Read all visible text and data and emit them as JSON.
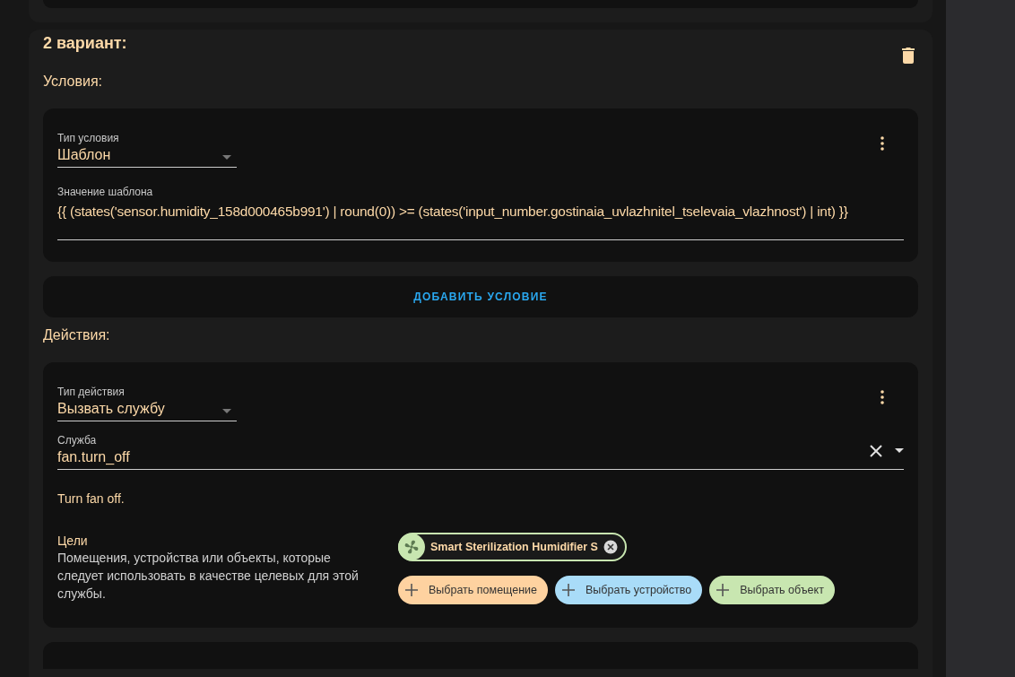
{
  "variant": {
    "title": "2 вариант:"
  },
  "conditions": {
    "heading": "Условия:",
    "items": [
      {
        "type_label": "Тип условия",
        "type_value": "Шаблон",
        "field_label": "Значение шаблона",
        "field_value": "{{ (states('sensor.humidity_158d000465b991') | round(0)) >= (states('input_number.gostinaia_uvlazhnitel_tselevaia_vlazhnost') | int) }}"
      }
    ],
    "add_button": "ДОБАВИТЬ УСЛОВИЕ"
  },
  "actions": {
    "heading": "Действия:",
    "items": [
      {
        "type_label": "Тип действия",
        "type_value": "Вызвать службу",
        "service_label": "Служба",
        "service_value": "fan.turn_off",
        "description": "Turn fan off.",
        "targets": {
          "label": "Цели",
          "help": "Помещения, устройства или объекты, которые следует использовать в качестве целевых для этой службы.",
          "selected": [
            {
              "name": "Smart Sterilization Humidifier S",
              "color": "#c8e6b0"
            }
          ],
          "pickers": [
            {
              "label": "Выбрать помещение",
              "color": "#fed2a0"
            },
            {
              "label": "Выбрать устройство",
              "color": "#a9dcf8"
            },
            {
              "label": "Выбрать объект",
              "color": "#c8e6b0"
            }
          ]
        }
      }
    ]
  }
}
